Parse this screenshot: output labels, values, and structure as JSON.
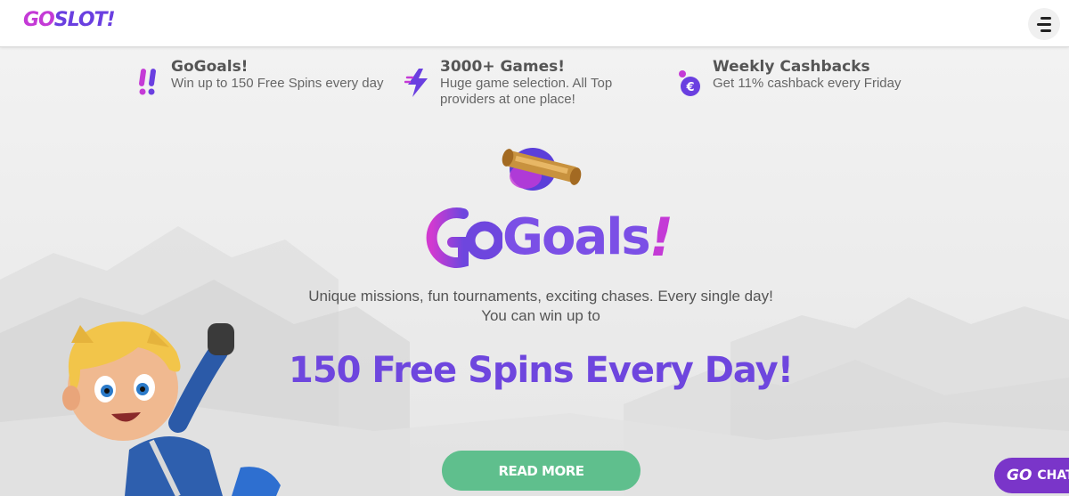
{
  "header": {
    "logo_go": "GO",
    "logo_slot": "SLOT!"
  },
  "features": [
    {
      "title": "GoGoals!",
      "desc_lines": [
        "Win up to 150 Free Spins every day"
      ],
      "icon": "exclamation-icon"
    },
    {
      "title": "3000+ Games!",
      "desc_lines": [
        "Huge game selection. All Top",
        "providers at one place!"
      ],
      "icon": "lightning-icon"
    },
    {
      "title": "Weekly Cashbacks",
      "desc_lines": [
        "Get 11% cashback every Friday"
      ],
      "icon": "euro-coin-icon"
    }
  ],
  "promo": {
    "brand_goals": "Goals",
    "brand_excl": "!",
    "desc_line1": "Unique missions, fun tournaments, exciting chases. Every single day!",
    "desc_line2": "You can win up to",
    "headline": "150 Free Spins Every Day!",
    "cta": "READ MORE"
  },
  "chat": {
    "go": "GO",
    "label": "CHAT"
  },
  "colors": {
    "accent_purple": "#6e46de",
    "accent_magenta": "#c43ad6",
    "cta_green": "#5fbf8d",
    "chat_purple": "#7a35c9"
  }
}
